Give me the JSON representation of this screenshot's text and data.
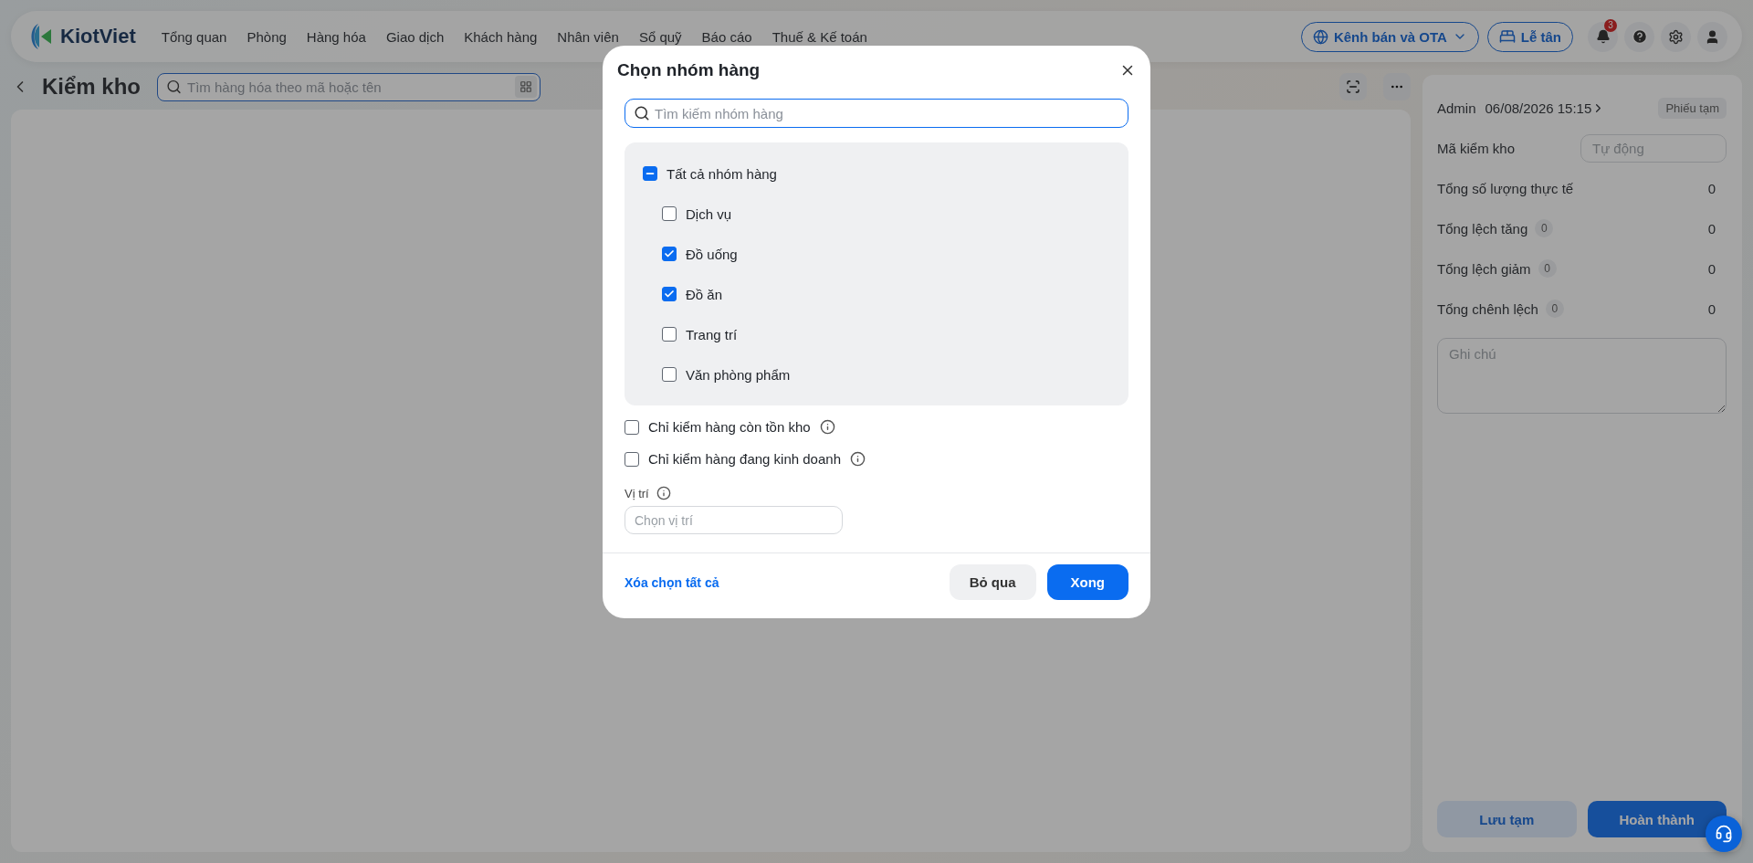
{
  "app": {
    "logo_text": "KiotViet"
  },
  "nav": {
    "items": [
      "Tổng quan",
      "Phòng",
      "Hàng hóa",
      "Giao dịch",
      "Khách hàng",
      "Nhân viên",
      "Sổ quỹ",
      "Báo cáo",
      "Thuế & Kế toán"
    ],
    "channel_button": "Kênh bán và OTA",
    "reception_button": "Lễ tân",
    "notification_count": "3"
  },
  "page": {
    "title": "Kiểm kho",
    "search": {
      "placeholder": "Tìm hàng hóa theo mã hoặc tên"
    }
  },
  "summary": {
    "user": "Admin",
    "datetime": "06/08/2026 15:15",
    "status": "Phiếu tạm",
    "code": {
      "label": "Mã kiểm kho",
      "placeholder": "Tự động"
    },
    "rows": [
      {
        "label": "Tổng số lượng thực tế",
        "value": "0"
      },
      {
        "label": "Tổng lệch tăng",
        "count": "0",
        "value": "0"
      },
      {
        "label": "Tổng lệch giảm",
        "count": "0",
        "value": "0"
      },
      {
        "label": "Tổng chênh lệch",
        "count": "0",
        "value": "0"
      }
    ],
    "note": {
      "placeholder": "Ghi chú"
    },
    "buttons": [
      {
        "label": "Lưu tạm",
        "kind": "secondary"
      },
      {
        "label": "Hoàn thành",
        "kind": "primary"
      }
    ]
  },
  "dialog": {
    "title": "Chọn nhóm hàng",
    "search": {
      "placeholder": "Tìm kiếm nhóm hàng"
    },
    "groups": {
      "label": "Tất cả nhóm hàng",
      "checked": false,
      "indeterminate": true,
      "children": [
        {
          "label": "Dịch vụ",
          "checked": false
        },
        {
          "label": "Đồ uống",
          "checked": true
        },
        {
          "label": "Đồ ăn",
          "checked": true
        },
        {
          "label": "Trang trí",
          "checked": false
        },
        {
          "label": "Văn phòng phẩm",
          "checked": false
        }
      ]
    },
    "options": [
      {
        "label": "Chỉ kiểm hàng còn tồn kho",
        "checked": false
      },
      {
        "label": "Chỉ kiểm hàng đang kinh doanh",
        "checked": false
      }
    ],
    "location": {
      "label": "Vị trí",
      "placeholder": "Chọn vị trí"
    },
    "clear_link": "Xóa chọn tất cả",
    "buttons": [
      {
        "label": "Bỏ qua",
        "kind": "secondary"
      },
      {
        "label": "Xong",
        "kind": "primary"
      }
    ]
  }
}
